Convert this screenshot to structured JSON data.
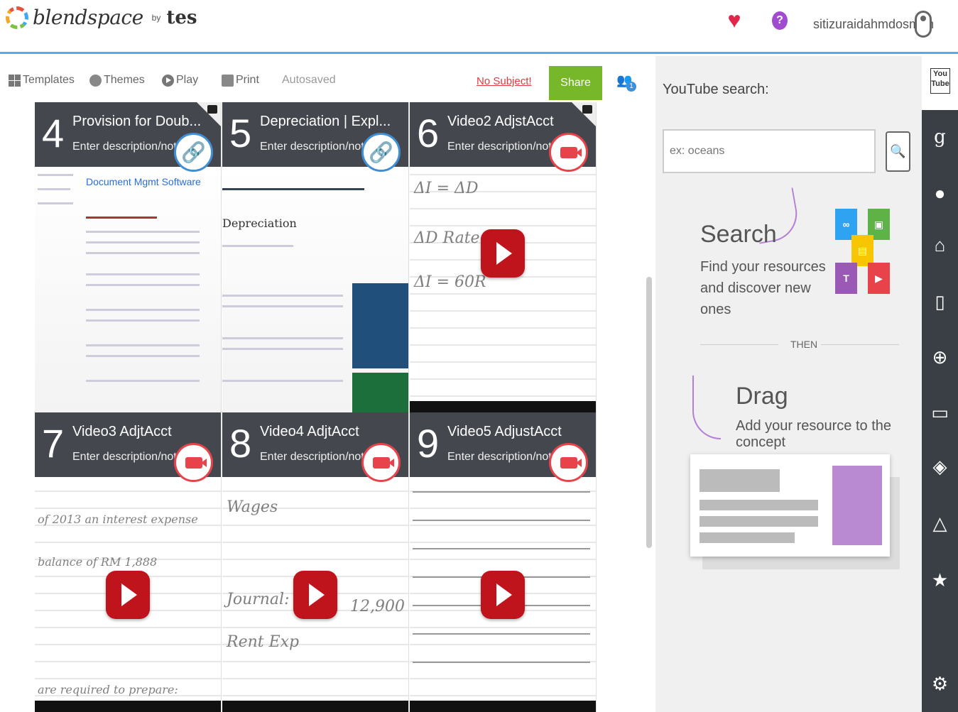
{
  "header": {
    "logo_text": "blendspace",
    "logo_by": "by",
    "logo_partner": "tes",
    "favorites_icon": "heart-icon",
    "help_icon": "question-icon",
    "help_glyph": "?",
    "username": "sitizuraidahmdosman"
  },
  "toolbar": {
    "templates": "Templates",
    "themes": "Themes",
    "play": "Play",
    "print": "Print",
    "autosaved": "Autosaved",
    "no_subject": "No Subject!",
    "share": "Share",
    "collaborators_count": "1"
  },
  "tiles": [
    {
      "num": "4",
      "title": "Provision for Doub...",
      "desc": "Enter description/notes",
      "type": "link",
      "doc_link": "Document Mgmt Software"
    },
    {
      "num": "5",
      "title": "Depreciation | Expl...",
      "desc": "Enter description/notes",
      "type": "link",
      "doc_link": "Depreciation"
    },
    {
      "num": "6",
      "title": "Video2 AdjstAcct",
      "desc": "Enter description/notes",
      "type": "video"
    },
    {
      "num": "7",
      "title": "Video3 AdjtAcct",
      "desc": "Enter description/notes",
      "type": "video"
    },
    {
      "num": "8",
      "title": "Video4 AdjtAcct",
      "desc": "Enter description/notes",
      "type": "video"
    },
    {
      "num": "9",
      "title": "Video5 AdjustAcct",
      "desc": "Enter description/notes",
      "type": "video"
    }
  ],
  "panel": {
    "title": "YouTube search:",
    "search_placeholder": "ex: oceans",
    "search_heading": "Search",
    "search_sub": "Find your resources and discover new ones",
    "then": "THEN",
    "drag_heading": "Drag",
    "drag_sub": "Add your resource to the concept"
  },
  "sidebar": {
    "youtube_logo": "You Tube",
    "items": [
      "google-icon",
      "flickr-icon",
      "gooru-icon",
      "educreations-icon",
      "web-icon",
      "screen-icon",
      "dropbox-icon",
      "drive-icon",
      "favorites-icon",
      "settings-icon"
    ]
  },
  "colors": {
    "accent_blue": "#5aa9e6",
    "share_green": "#76b82a",
    "video_red": "#e8434a",
    "sidebar_dark": "#3a3f45"
  }
}
